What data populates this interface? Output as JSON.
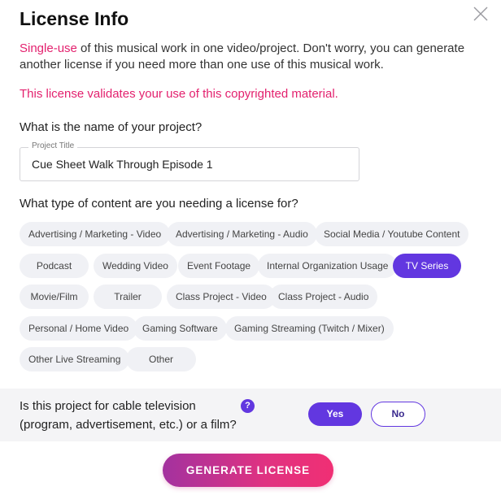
{
  "dialog": {
    "title": "License Info",
    "description_highlight": "Single-use",
    "description_rest": " of this musical work in one video/project. Don't worry, you can generate another license if you need more than one use of this musical work.",
    "validation_notice": "This license validates your use of this copyrighted material."
  },
  "project": {
    "question": "What is the name of your project?",
    "field_label": "Project Title",
    "field_value": "Cue Sheet Walk Through Episode 1"
  },
  "content_type": {
    "question": "What type of content are you needing a license for?",
    "options": [
      "Advertising / Marketing - Video",
      "Advertising / Marketing - Audio",
      "Social Media / Youtube Content",
      "Podcast",
      "Wedding Video",
      "Event Footage",
      "Internal Organization Usage",
      "TV Series",
      "Movie/Film",
      "Trailer",
      "Class Project - Video",
      "Class Project - Audio",
      "Personal / Home Video",
      "Gaming Software",
      "Gaming Streaming (Twitch / Mixer)",
      "Other Live Streaming",
      "Other"
    ],
    "selected": "TV Series"
  },
  "cable": {
    "question": "Is this project for cable television (program, advertisement, etc.) or a film?",
    "help_icon": "?",
    "yes_label": "Yes",
    "no_label": "No",
    "selected": "Yes"
  },
  "generate_label": "GENERATE LICENSE",
  "colors": {
    "accent": "#6237e0",
    "pink": "#e3216e",
    "chip_bg": "#f0f1f5",
    "gradient_start": "#a3329f",
    "gradient_end": "#f02f74"
  }
}
